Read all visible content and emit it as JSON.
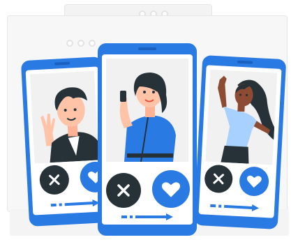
{
  "colors": {
    "accent": "#2a7ae4",
    "dark": "#263238",
    "background_window": "#f3f3f3"
  },
  "icons": {
    "reject": "close-icon",
    "like": "heart-icon",
    "swipe": "arrow-right-icon"
  },
  "phones": [
    {
      "position": "left",
      "person": "person-waving"
    },
    {
      "position": "center",
      "person": "person-on-phone"
    },
    {
      "position": "right",
      "person": "person-dancing"
    }
  ]
}
